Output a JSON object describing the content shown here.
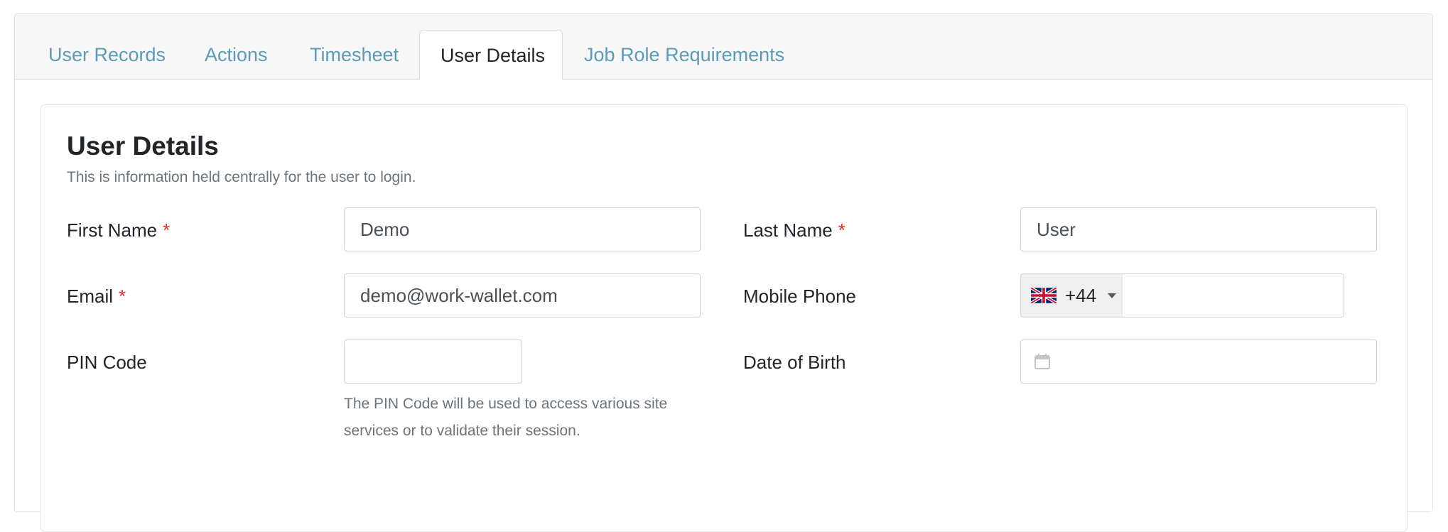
{
  "tabs": [
    {
      "label": "User Records",
      "active": false
    },
    {
      "label": "Actions",
      "active": false
    },
    {
      "label": "Timesheet",
      "active": false
    },
    {
      "label": "User Details",
      "active": true
    },
    {
      "label": "Job Role Requirements",
      "active": false
    }
  ],
  "card": {
    "title": "User Details",
    "subtitle": "This is information held centrally for the user to login."
  },
  "form": {
    "first_name": {
      "label": "First Name",
      "value": "Demo",
      "required_mark": "*"
    },
    "last_name": {
      "label": "Last Name",
      "value": "User",
      "required_mark": "*"
    },
    "email": {
      "label": "Email",
      "value": "demo@work-wallet.com",
      "required_mark": "*"
    },
    "mobile_phone": {
      "label": "Mobile Phone",
      "country_flag": "uk-flag-icon",
      "dial_code": "+44",
      "value": ""
    },
    "pin_code": {
      "label": "PIN Code",
      "value": "",
      "help": "The PIN Code will be used to access various site services or to validate their session."
    },
    "date_of_birth": {
      "label": "Date of Birth",
      "value": "",
      "icon": "calendar-icon"
    }
  },
  "colors": {
    "tab_link": "#5d9bb5",
    "required": "#d9302c",
    "muted_text": "#6c757d"
  }
}
